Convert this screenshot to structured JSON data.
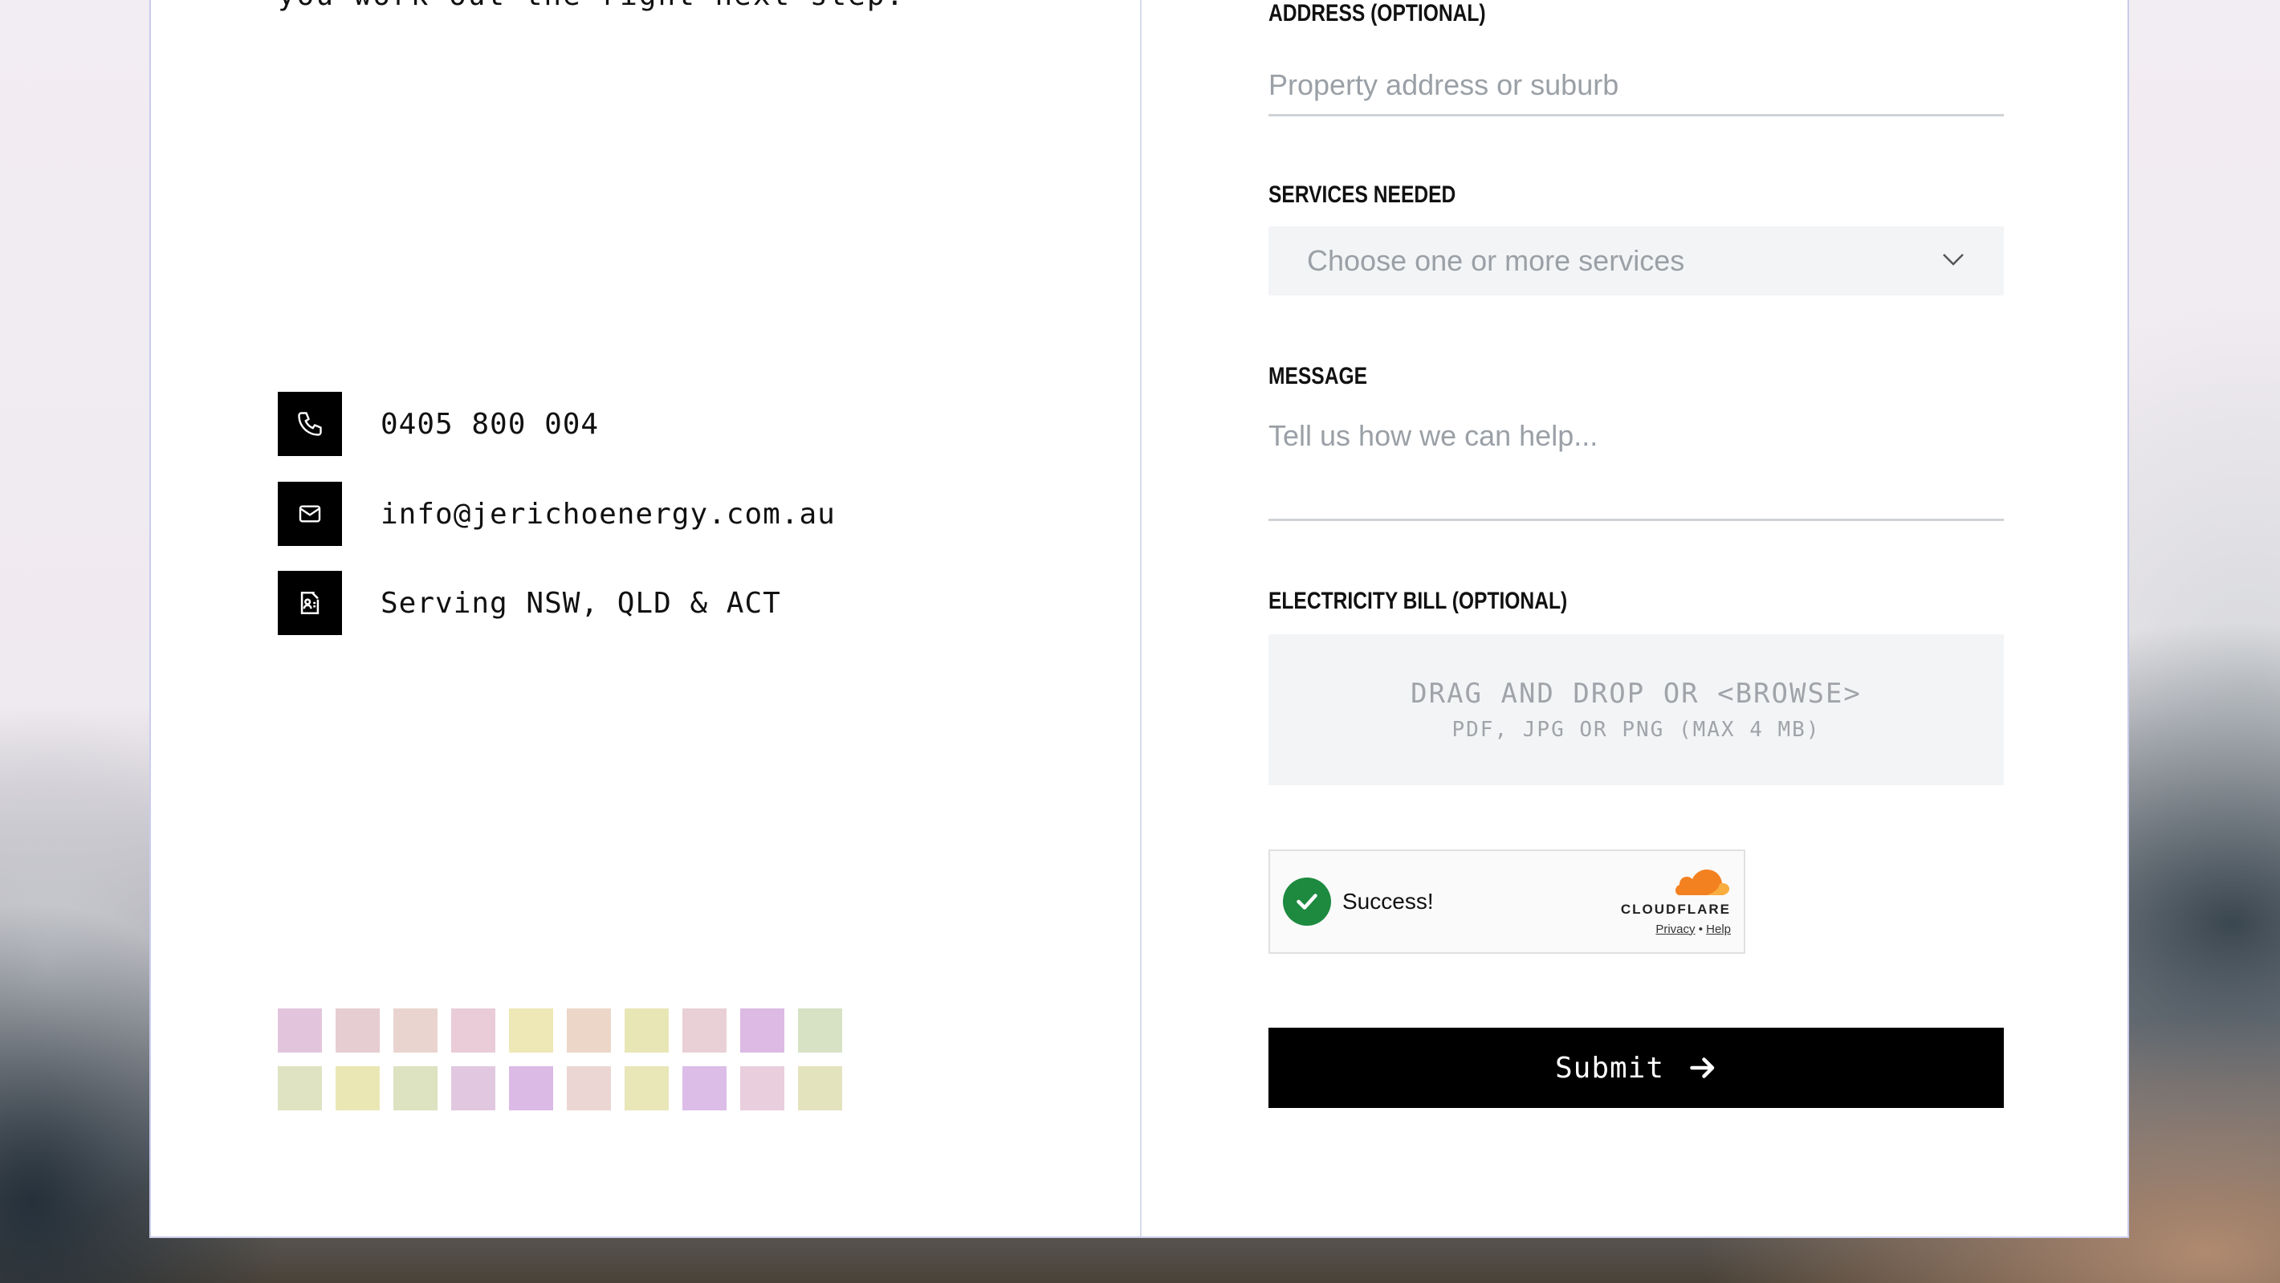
{
  "intro": {
    "text_fragment": "you work out the right next step."
  },
  "contact": {
    "phone": "0405 800 004",
    "email": "info@jerichoenergy.com.au",
    "area": "Serving NSW, QLD & ACT"
  },
  "swatches": [
    [
      "#e2c5dc",
      "#e6cdd2",
      "#e9d4cf",
      "#e9ccd8",
      "#ede8b6",
      "#ecd6c7",
      "#e9e6b6",
      "#e8d0d6",
      "#dcbae4",
      "#d7e1c4"
    ],
    [
      "#dfe3c2",
      "#ebe7b5",
      "#dde2c0",
      "#e1c8e0",
      "#dbbae6",
      "#ecd6d3",
      "#e9e6b8",
      "#dbbde8",
      "#e9cedd",
      "#e3e3be"
    ]
  ],
  "form": {
    "address_label": "Address (optional)",
    "address_placeholder": "Property address or suburb",
    "services_label": "Services needed",
    "services_placeholder": "Choose one or more services",
    "message_label": "Message",
    "message_placeholder": "Tell us how we can help...",
    "bill_label": "Electricity bill (optional)",
    "dropzone_main": "DRAG AND DROP OR <BROWSE>",
    "dropzone_sub": "PDF, JPG OR PNG (MAX 4 MB)",
    "submit_label": "Submit"
  },
  "turnstile": {
    "status": "Success!",
    "brand": "CLOUDFLARE",
    "privacy": "Privacy",
    "separator": "•",
    "help": "Help"
  }
}
